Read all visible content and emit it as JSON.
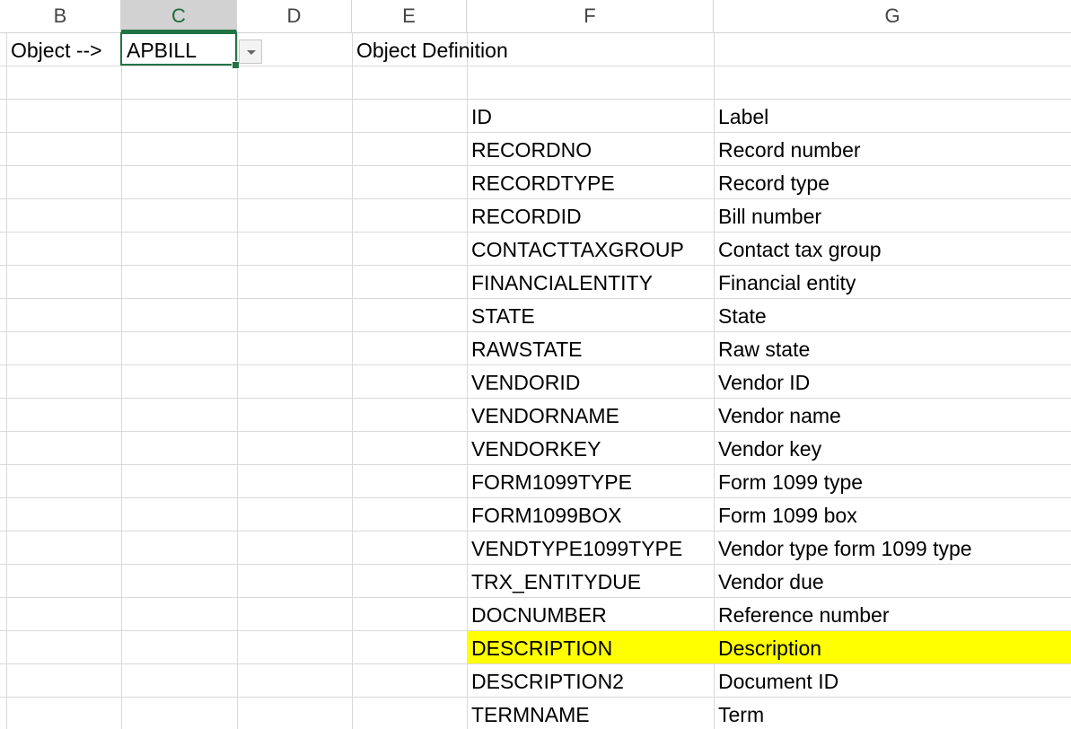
{
  "columns": [
    "B",
    "C",
    "D",
    "E",
    "F",
    "G"
  ],
  "selected_column": "C",
  "row1": {
    "object_label": "Object -->",
    "object_value": "APBILL",
    "definition_label": "Object Definition"
  },
  "table": {
    "headers": {
      "id": "ID",
      "label": "Label"
    },
    "rows": [
      {
        "id": "RECORDNO",
        "label": "Record number"
      },
      {
        "id": "RECORDTYPE",
        "label": "Record type"
      },
      {
        "id": "RECORDID",
        "label": "Bill number"
      },
      {
        "id": "CONTACTTAXGROUP",
        "label": "Contact tax group"
      },
      {
        "id": "FINANCIALENTITY",
        "label": "Financial entity"
      },
      {
        "id": "STATE",
        "label": "State"
      },
      {
        "id": "RAWSTATE",
        "label": "Raw state"
      },
      {
        "id": "VENDORID",
        "label": "Vendor ID"
      },
      {
        "id": "VENDORNAME",
        "label": "Vendor name"
      },
      {
        "id": "VENDORKEY",
        "label": "Vendor key"
      },
      {
        "id": "FORM1099TYPE",
        "label": "Form 1099 type"
      },
      {
        "id": "FORM1099BOX",
        "label": "Form 1099 box"
      },
      {
        "id": "VENDTYPE1099TYPE",
        "label": "Vendor type form 1099 type"
      },
      {
        "id": "TRX_ENTITYDUE",
        "label": "Vendor due"
      },
      {
        "id": "DOCNUMBER",
        "label": "Reference number"
      },
      {
        "id": "DESCRIPTION",
        "label": "Description",
        "highlighted": true
      },
      {
        "id": "DESCRIPTION2",
        "label": "Document ID"
      },
      {
        "id": "TERMNAME",
        "label": "Term"
      }
    ]
  },
  "colors": {
    "highlight": "#ffff00",
    "selection": "#217346",
    "gridline": "#d9d9d9"
  },
  "icons": {
    "dropdown": "chevron-down-icon"
  }
}
